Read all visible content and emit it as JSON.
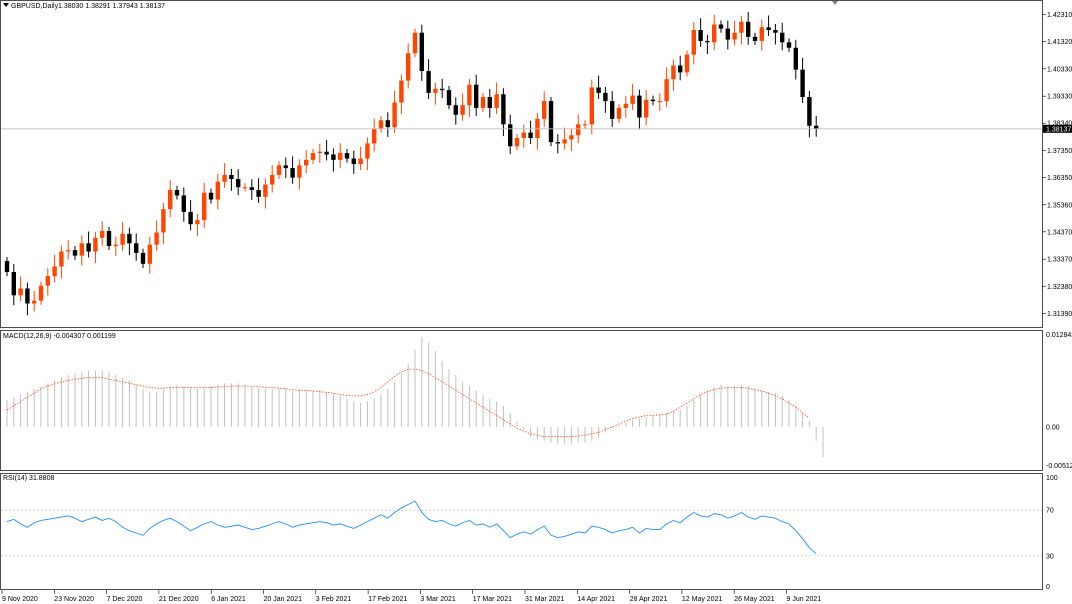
{
  "main_panel": {
    "symbol": "GBPUSD,Daily",
    "ohlc_text": "1.38030 1.38291 1.37943 1.38137",
    "current_price": "1.38137",
    "price_ticks": [
      "1.42310",
      "1.41320",
      "1.40330",
      "1.39330",
      "1.38340",
      "1.37350",
      "1.36350",
      "1.35360",
      "1.34370",
      "1.33370",
      "1.32380",
      "1.31390"
    ]
  },
  "macd_panel": {
    "label": "MACD(12,26,9) -0.004307 0.001199",
    "ticks": [
      "0.012842",
      "0.00",
      "-0.005124"
    ]
  },
  "rsi_panel": {
    "label": "RSI(14) 31.8808",
    "ticks": [
      "100",
      "70",
      "30",
      "0"
    ]
  },
  "time_axis": [
    "9 Nov 2020",
    "23 Nov 2020",
    "7 Dec 2020",
    "21 Dec 2020",
    "6 Jan 2021",
    "20 Jan 2021",
    "3 Feb 2021",
    "17 Feb 2021",
    "3 Mar 2021",
    "17 Mar 2021",
    "31 Mar 2021",
    "14 Apr 2021",
    "28 Apr 2021",
    "12 May 2021",
    "26 May 2021",
    "9 Jun 2021"
  ],
  "colors": {
    "bull": "#ff4500",
    "bear": "#000000",
    "macd_hist": "#c0c0c0",
    "macd_signal": "#ff4500",
    "rsi_line": "#1e90ff",
    "grid": "#c0c0c0"
  },
  "chart_data": {
    "type": "candlestick",
    "close_series": [
      1.329,
      1.3205,
      1.323,
      1.3175,
      1.3185,
      1.324,
      1.3275,
      1.331,
      1.3365,
      1.337,
      1.335,
      1.3395,
      1.3365,
      1.3415,
      1.344,
      1.3385,
      1.339,
      1.343,
      1.3395,
      1.336,
      1.332,
      1.339,
      1.3435,
      1.352,
      1.359,
      1.357,
      1.351,
      1.3465,
      1.348,
      1.358,
      1.3555,
      1.362,
      1.3645,
      1.363,
      1.36,
      1.36,
      1.359,
      1.3565,
      1.361,
      1.3645,
      1.368,
      1.367,
      1.3635,
      1.368,
      1.37,
      1.3725,
      1.373,
      1.372,
      1.37,
      1.3725,
      1.3705,
      1.3685,
      1.3705,
      1.376,
      1.3815,
      1.3845,
      1.382,
      1.391,
      1.399,
      1.409,
      1.4165,
      1.4025,
      1.3945,
      1.396,
      1.3955,
      1.39,
      1.3865,
      1.39,
      1.3975,
      1.389,
      1.393,
      1.389,
      1.394,
      1.383,
      1.375,
      1.378,
      1.38,
      1.378,
      1.385,
      1.3915,
      1.3765,
      1.376,
      1.3775,
      1.379,
      1.383,
      1.383,
      1.3965,
      1.3945,
      1.3915,
      1.385,
      1.389,
      1.3905,
      1.3935,
      1.3855,
      1.392,
      1.3915,
      1.3915,
      1.3995,
      1.4045,
      1.402,
      1.4085,
      1.4175,
      1.4135,
      1.413,
      1.4195,
      1.418,
      1.414,
      1.4165,
      1.4205,
      1.415,
      1.4135,
      1.4185,
      1.4175,
      1.4165,
      1.413,
      1.411,
      1.403,
      1.393,
      1.3825,
      1.38137
    ],
    "macd_histogram": [
      0.0038,
      0.0042,
      0.0046,
      0.005,
      0.0054,
      0.0058,
      0.0062,
      0.0066,
      0.007,
      0.0074,
      0.0076,
      0.0078,
      0.008,
      0.008,
      0.008,
      0.0078,
      0.0074,
      0.007,
      0.0066,
      0.006,
      0.0054,
      0.005,
      0.005,
      0.0054,
      0.0058,
      0.006,
      0.0058,
      0.0056,
      0.0054,
      0.0056,
      0.0058,
      0.006,
      0.0062,
      0.0062,
      0.0062,
      0.006,
      0.0058,
      0.0056,
      0.0054,
      0.0054,
      0.0054,
      0.0054,
      0.0052,
      0.0052,
      0.0052,
      0.0052,
      0.0052,
      0.005,
      0.0048,
      0.0044,
      0.004,
      0.0036,
      0.0034,
      0.0036,
      0.004,
      0.0046,
      0.0054,
      0.0064,
      0.0076,
      0.009,
      0.011,
      0.0128,
      0.012,
      0.0108,
      0.0094,
      0.0082,
      0.0074,
      0.0064,
      0.0058,
      0.0052,
      0.0046,
      0.004,
      0.0036,
      0.003,
      0.002,
      0.0008,
      -0.0004,
      -0.0014,
      -0.0018,
      -0.002,
      -0.0022,
      -0.0024,
      -0.0024,
      -0.0024,
      -0.0022,
      -0.0022,
      -0.002,
      -0.0016,
      -0.0008,
      -0.0002,
      0.0002,
      0.0006,
      0.001,
      0.0012,
      0.0014,
      0.0016,
      0.0018,
      0.002,
      0.0022,
      0.0024,
      0.003,
      0.0038,
      0.0046,
      0.0052,
      0.0056,
      0.006,
      0.0058,
      0.0058,
      0.006,
      0.0058,
      0.0054,
      0.0052,
      0.005,
      0.0048,
      0.0044,
      0.0038,
      0.003,
      0.002,
      0.0008,
      -0.002,
      -0.0043
    ],
    "macd_signal": [
      0.0024,
      0.003,
      0.0036,
      0.0042,
      0.0048,
      0.0054,
      0.0058,
      0.0061,
      0.0064,
      0.0066,
      0.0068,
      0.0069,
      0.007,
      0.007,
      0.007,
      0.0068,
      0.0066,
      0.0064,
      0.0062,
      0.006,
      0.0058,
      0.0056,
      0.0055,
      0.0055,
      0.0056,
      0.0056,
      0.0056,
      0.0056,
      0.0056,
      0.0056,
      0.0056,
      0.0057,
      0.0057,
      0.0058,
      0.0058,
      0.0058,
      0.0058,
      0.0057,
      0.0056,
      0.0056,
      0.0055,
      0.0054,
      0.0053,
      0.0052,
      0.0052,
      0.0051,
      0.005,
      0.0049,
      0.0048,
      0.0046,
      0.0045,
      0.0044,
      0.0044,
      0.0046,
      0.005,
      0.0056,
      0.0064,
      0.0072,
      0.0078,
      0.0082,
      0.0082,
      0.008,
      0.0076,
      0.007,
      0.0064,
      0.0058,
      0.0052,
      0.0046,
      0.004,
      0.0034,
      0.0028,
      0.0022,
      0.0016,
      0.001,
      0.0004,
      -0.0002,
      -0.0006,
      -0.001,
      -0.0012,
      -0.0014,
      -0.0014,
      -0.0014,
      -0.0014,
      -0.0014,
      -0.0013,
      -0.0012,
      -0.001,
      -0.0008,
      -0.0004,
      0.0,
      0.0004,
      0.0008,
      0.0012,
      0.0014,
      0.0016,
      0.0016,
      0.0017,
      0.0018,
      0.0022,
      0.0028,
      0.0034,
      0.004,
      0.0046,
      0.005,
      0.0053,
      0.0055,
      0.0056,
      0.0056,
      0.0056,
      0.0055,
      0.0053,
      0.0051,
      0.0048,
      0.0044,
      0.004,
      0.0034,
      0.0028,
      0.002,
      0.0012
    ],
    "rsi": [
      60,
      62,
      58,
      55,
      59,
      61,
      62,
      63,
      64,
      65,
      63,
      60,
      62,
      64,
      61,
      63,
      60,
      55,
      52,
      50,
      48,
      54,
      58,
      61,
      63,
      60,
      56,
      52,
      55,
      58,
      60,
      57,
      55,
      56,
      57,
      55,
      53,
      54,
      56,
      58,
      60,
      58,
      55,
      57,
      58,
      59,
      60,
      59,
      57,
      58,
      56,
      54,
      57,
      60,
      63,
      66,
      63,
      68,
      72,
      75,
      78,
      68,
      62,
      60,
      61,
      58,
      56,
      59,
      61,
      57,
      58,
      55,
      58,
      52,
      46,
      49,
      51,
      49,
      53,
      56,
      48,
      46,
      47,
      49,
      51,
      50,
      56,
      55,
      53,
      50,
      52,
      53,
      55,
      50,
      54,
      53,
      53,
      58,
      61,
      59,
      64,
      68,
      65,
      64,
      67,
      66,
      63,
      65,
      68,
      64,
      62,
      65,
      64,
      63,
      60,
      58,
      52,
      45,
      37,
      31.88
    ],
    "price_ylim": [
      1.31,
      1.427
    ],
    "macd_ylim": [
      -0.006,
      0.0135
    ],
    "rsi_ylim": [
      0,
      100
    ],
    "rsi_levels": [
      70,
      30
    ]
  }
}
